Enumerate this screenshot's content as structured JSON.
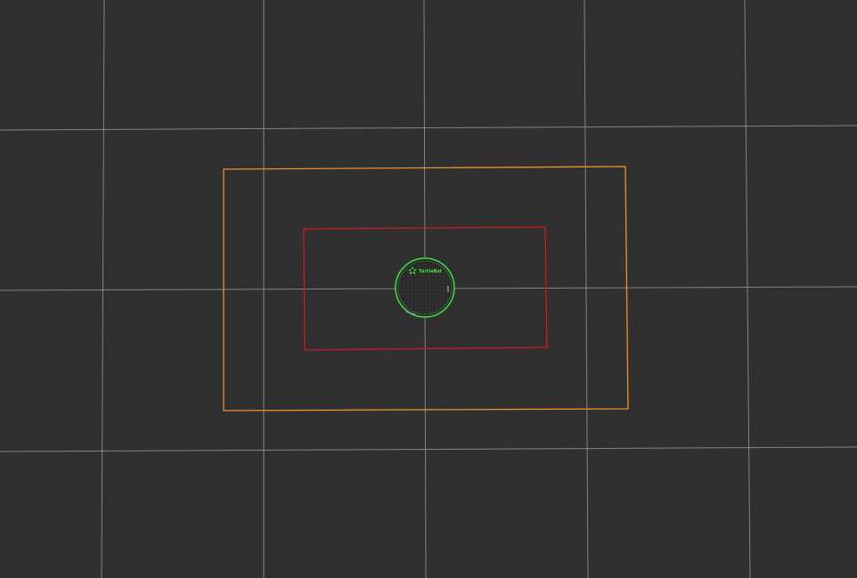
{
  "view": {
    "background_color": "#303030",
    "grid_color": "#a0a0a0"
  },
  "footprints": {
    "outer": {
      "color": "#f0902a"
    },
    "inner": {
      "color": "#c81e1e"
    }
  },
  "robot": {
    "logo_text": "TurtleBot",
    "outline_color": "#3ee03e",
    "body_color": "#2a2a2a",
    "logo_icon": "turtlebot-logo-icon"
  }
}
